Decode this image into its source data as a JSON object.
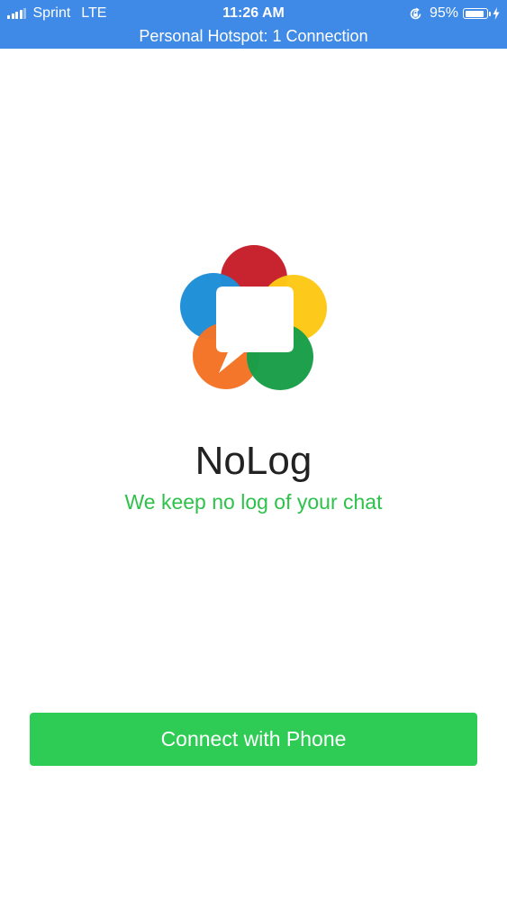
{
  "status_bar": {
    "carrier": "Sprint",
    "network": "LTE",
    "time": "11:26 AM",
    "battery_percent": "95%",
    "battery_level": 0.95,
    "signal_bars_active": 4,
    "signal_bars_total": 5,
    "icons": [
      "signal-icon",
      "orientation-lock-icon",
      "battery-icon",
      "charging-bolt-icon"
    ],
    "background_color": "#3f8ae6"
  },
  "hotspot_banner": {
    "text": "Personal Hotspot: 1 Connection"
  },
  "logo": {
    "icon": "webrtc-logo-icon",
    "colors": {
      "red": "#c7202b",
      "yellow": "#fdc816",
      "blue": "#1f8fd7",
      "orange": "#f47327",
      "green": "#1a9e49"
    }
  },
  "app": {
    "title": "NoLog",
    "tagline": "We keep no log of your chat"
  },
  "actions": {
    "connect_label": "Connect with Phone"
  },
  "colors": {
    "accent_green": "#2ecc55",
    "tagline_green": "#2ec14b",
    "title_text": "#222222"
  }
}
